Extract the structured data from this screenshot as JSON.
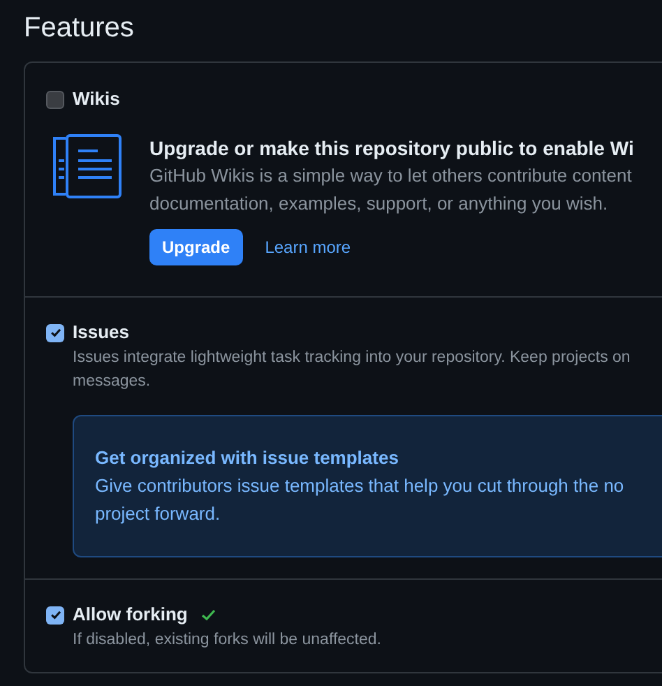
{
  "heading": "Features",
  "features": [
    {
      "kind": "upsell",
      "label": "Wikis",
      "checked": false,
      "upsell": {
        "title": "Upgrade or make this repository public to enable Wi",
        "lines": [
          "GitHub Wikis is a simple way to let others contribute content",
          "documentation, examples, support, or anything you wish."
        ],
        "button": "Upgrade",
        "link": "Learn more"
      }
    },
    {
      "kind": "tip",
      "label": "Issues",
      "checked": true,
      "description": [
        "Issues integrate lightweight task tracking into your repository. Keep projects on",
        "messages."
      ],
      "tip": {
        "title": "Get organized with issue templates",
        "lines": [
          "Give contributors issue templates that help you cut through the no",
          "project forward."
        ]
      }
    },
    {
      "kind": "plain",
      "label": "Allow forking",
      "checked": true,
      "saved": true,
      "description": [
        "If disabled, existing forks will be unaffected."
      ]
    }
  ]
}
